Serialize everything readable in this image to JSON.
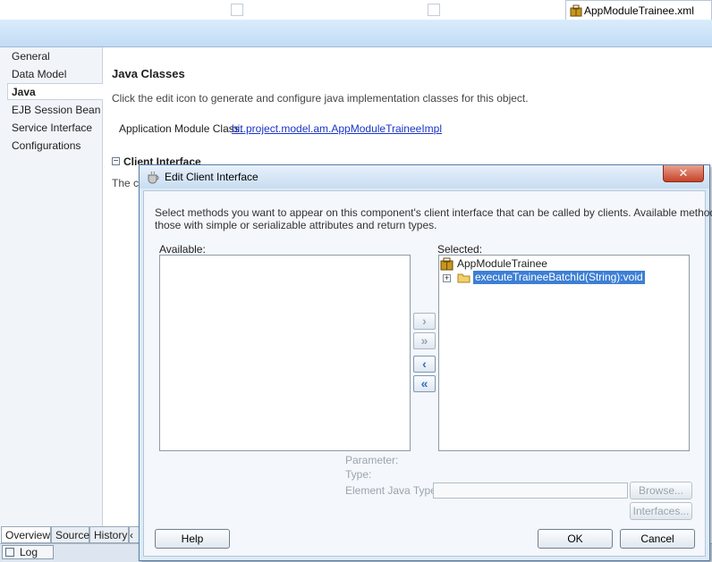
{
  "editor_tab": {
    "label": "AppModuleTrainee.xml"
  },
  "nav": {
    "items": [
      {
        "label": "General"
      },
      {
        "label": "Data Model"
      },
      {
        "label": "Java"
      },
      {
        "label": "EJB Session Bean"
      },
      {
        "label": "Service Interface"
      },
      {
        "label": "Configurations"
      }
    ]
  },
  "main": {
    "section_title": "Java Classes",
    "description": "Click the edit icon to generate and configure java implementation classes for this object.",
    "app_module_class_label": "Application Module Class:",
    "app_module_class_link": "bit.project.model.am.AppModuleTraineeImpl",
    "client_interface_heading": "Client Interface",
    "client_interface_partial": "The cl",
    "collapse_symbol": "−"
  },
  "bottom_tabs": [
    {
      "label": "Overview"
    },
    {
      "label": "Source"
    },
    {
      "label": "History"
    }
  ],
  "log_label": "Log",
  "dialog": {
    "title": "Edit Client Interface",
    "close_symbol": "✕",
    "instructions_line1": "Select methods you want to appear on this component's client interface that can be called by clients.  Available methods are",
    "instructions_line2": "those with simple or serializable attributes and return types.",
    "available_label": "Available:",
    "selected_label": "Selected:",
    "tree_root": "AppModuleTrainee",
    "tree_item": "executeTraineeBatchId(String):void",
    "move_right": "›",
    "move_all_right": "»",
    "move_left": "‹",
    "move_all_left": "«",
    "parameter_label": "Parameter:",
    "type_label": "Type:",
    "element_java_type_label": "Element Java Type:",
    "browse_button": "Browse...",
    "interfaces_button": "Interfaces...",
    "help_button": "Help",
    "ok_button": "OK",
    "cancel_button": "Cancel"
  },
  "colors": {
    "selection": "#3d7fd4",
    "link": "#1a34c7",
    "accent": "#2e6fc0"
  }
}
